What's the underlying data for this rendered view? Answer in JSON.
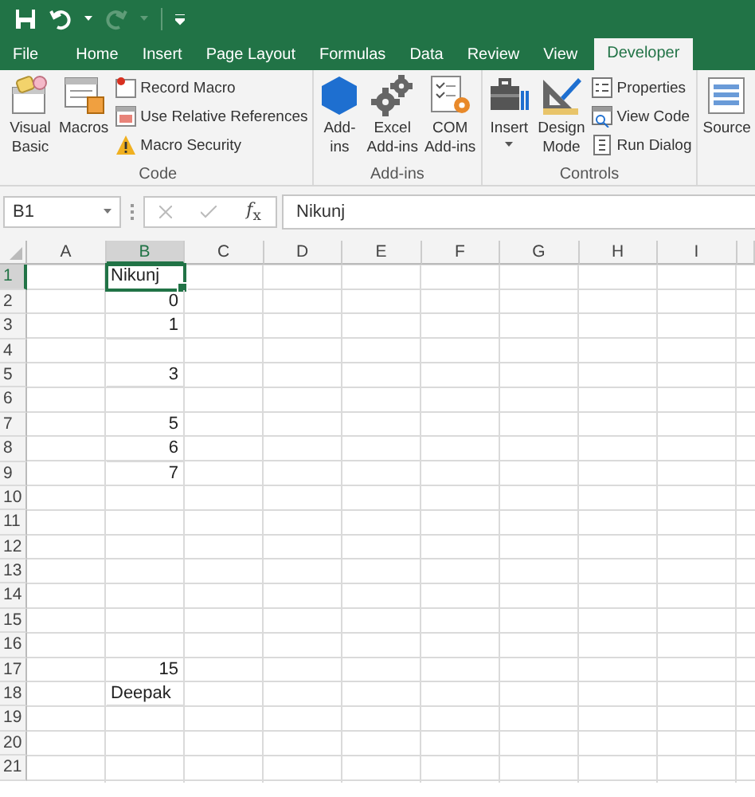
{
  "tabs": [
    {
      "label": "File",
      "kind": "file",
      "selected": false
    },
    {
      "label": "Home",
      "kind": "tab",
      "selected": false
    },
    {
      "label": "Insert",
      "kind": "tab",
      "selected": false
    },
    {
      "label": "Page Layout",
      "kind": "tab",
      "selected": false
    },
    {
      "label": "Formulas",
      "kind": "tab",
      "selected": false
    },
    {
      "label": "Data",
      "kind": "tab",
      "selected": false
    },
    {
      "label": "Review",
      "kind": "tab",
      "selected": false
    },
    {
      "label": "View",
      "kind": "tab",
      "selected": false
    },
    {
      "label": "Developer",
      "kind": "tab",
      "selected": true
    }
  ],
  "ribbon": {
    "groups": [
      {
        "label": "Code",
        "items": [
          {
            "kind": "large",
            "label": "Visual\nBasic"
          },
          {
            "kind": "large",
            "label": "Macros"
          },
          {
            "kind": "stack",
            "buttons": [
              {
                "label": "Record Macro"
              },
              {
                "label": "Use Relative References"
              },
              {
                "label": "Macro Security"
              }
            ]
          }
        ]
      },
      {
        "label": "Add-ins",
        "items": [
          {
            "kind": "large",
            "label": "Add-\nins"
          },
          {
            "kind": "large",
            "label": "Excel\nAdd-ins"
          },
          {
            "kind": "large",
            "label": "COM\nAdd-ins"
          }
        ]
      },
      {
        "label": "Controls",
        "items": [
          {
            "kind": "large",
            "label": "Insert",
            "dropdown": true
          },
          {
            "kind": "large",
            "label": "Design\nMode"
          },
          {
            "kind": "stack",
            "buttons": [
              {
                "label": "Properties"
              },
              {
                "label": "View Code"
              },
              {
                "label": "Run Dialog"
              }
            ]
          }
        ]
      },
      {
        "items": [
          {
            "kind": "large",
            "label": "Source"
          }
        ]
      }
    ]
  },
  "formula_bar": {
    "name_box": "B1",
    "function_button": "*f*$_{x}$",
    "value": "Nikunj"
  },
  "sheet": {
    "columns": [
      {
        "label": "A",
        "selected": false
      },
      {
        "label": "B",
        "selected": true
      },
      {
        "label": "C",
        "selected": false
      },
      {
        "label": "D",
        "selected": false
      },
      {
        "label": "E",
        "selected": false
      },
      {
        "label": "F",
        "selected": false
      },
      {
        "label": "G",
        "selected": false
      },
      {
        "label": "H",
        "selected": false
      },
      {
        "label": "I",
        "selected": false
      }
    ],
    "rows": [
      {
        "header": "1",
        "selected": true,
        "cell": {
          "text": "Nikunj",
          "kind": "text",
          "selected": true
        }
      },
      {
        "header": "2",
        "selected": false,
        "cell": {
          "text": "0",
          "kind": "number",
          "selected": false
        }
      },
      {
        "header": "3",
        "selected": false,
        "cell": {
          "text": "1",
          "kind": "number",
          "selected": false
        }
      },
      {
        "header": "4",
        "selected": false
      },
      {
        "header": "5",
        "selected": false,
        "cell": {
          "text": "3",
          "kind": "number",
          "selected": false
        }
      },
      {
        "header": "6",
        "selected": false
      },
      {
        "header": "7",
        "selected": false,
        "cell": {
          "text": "5",
          "kind": "number",
          "selected": false
        }
      },
      {
        "header": "8",
        "selected": false,
        "cell": {
          "text": "6",
          "kind": "number",
          "selected": false
        }
      },
      {
        "header": "9",
        "selected": false,
        "cell": {
          "text": "7",
          "kind": "number",
          "selected": false
        }
      },
      {
        "header": "10",
        "selected": false
      },
      {
        "header": "11",
        "selected": false
      },
      {
        "header": "12",
        "selected": false
      },
      {
        "header": "13",
        "selected": false
      },
      {
        "header": "14",
        "selected": false
      },
      {
        "header": "15",
        "selected": false
      },
      {
        "header": "16",
        "selected": false
      },
      {
        "header": "17",
        "selected": false,
        "cell": {
          "text": "15",
          "kind": "number",
          "selected": false
        }
      },
      {
        "header": "18",
        "selected": false,
        "cell": {
          "text": "Deepak",
          "kind": "text",
          "selected": false
        }
      },
      {
        "header": "19",
        "selected": false
      },
      {
        "header": "20",
        "selected": false
      },
      {
        "header": "21",
        "selected": false
      }
    ]
  }
}
